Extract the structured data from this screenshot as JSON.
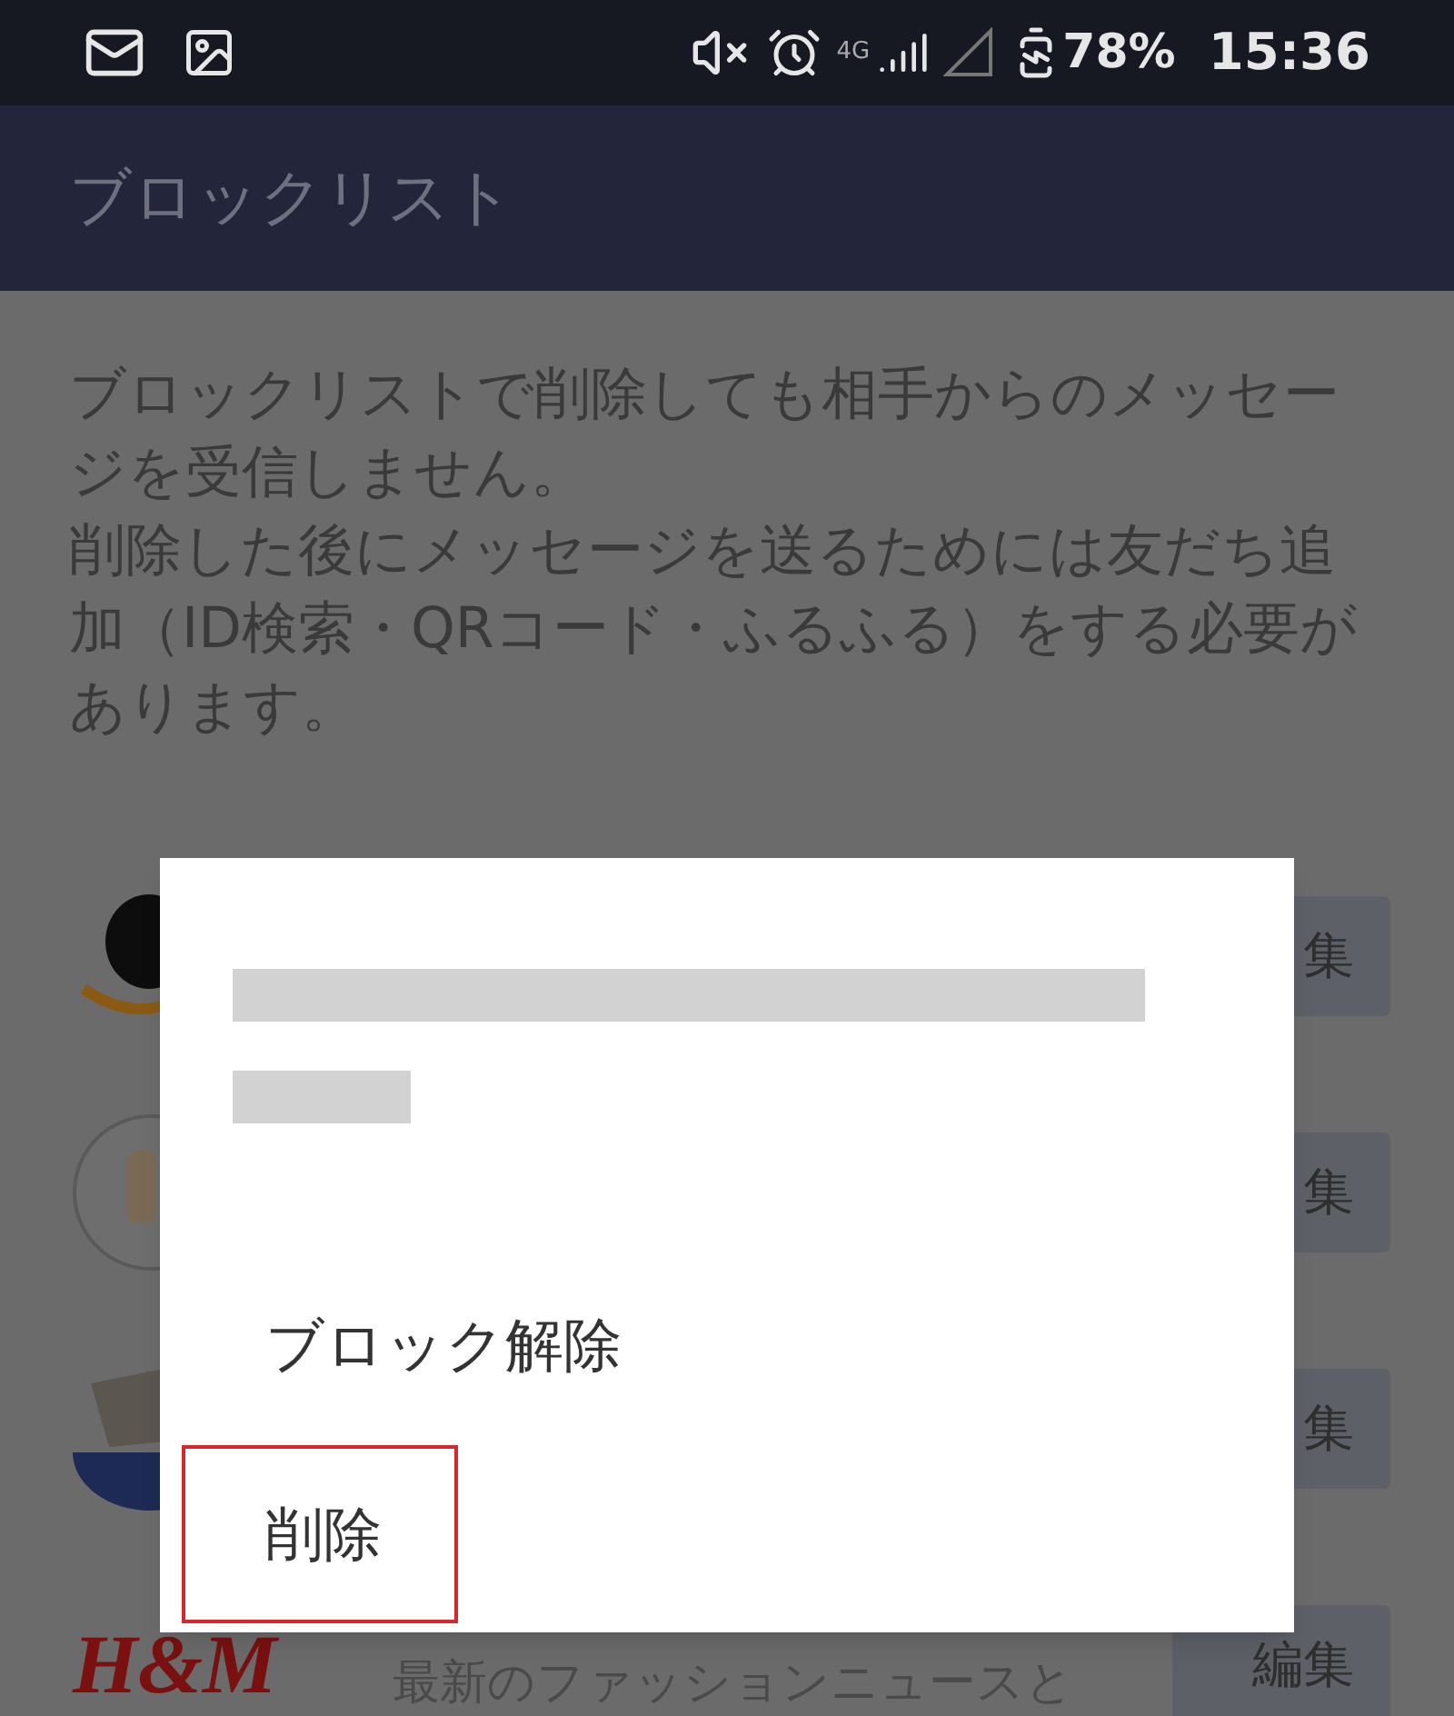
{
  "status_bar": {
    "network": "4G",
    "battery": "78%",
    "time": "15:36"
  },
  "header": {
    "title": "ブロックリスト"
  },
  "description": [
    "ブロックリストで削除しても相手からのメッセージを受信しません。",
    "削除した後にメッセージを送るためには友だち追加（ID検索・QRコード・ふるふる）をする必要があります。"
  ],
  "rows": [
    {
      "kind": "smile",
      "button": "集"
    },
    {
      "kind": "avatar",
      "button": "集"
    },
    {
      "kind": "badge",
      "button": "集"
    },
    {
      "kind": "text",
      "logo_text": "H&M",
      "subtitle": "最新のファッションニュースと",
      "button": "編集"
    }
  ],
  "dialog": {
    "title_redacted": true,
    "options": [
      {
        "label": "ブロック解除",
        "highlighted": false
      },
      {
        "label": "削除",
        "highlighted": true
      }
    ]
  }
}
